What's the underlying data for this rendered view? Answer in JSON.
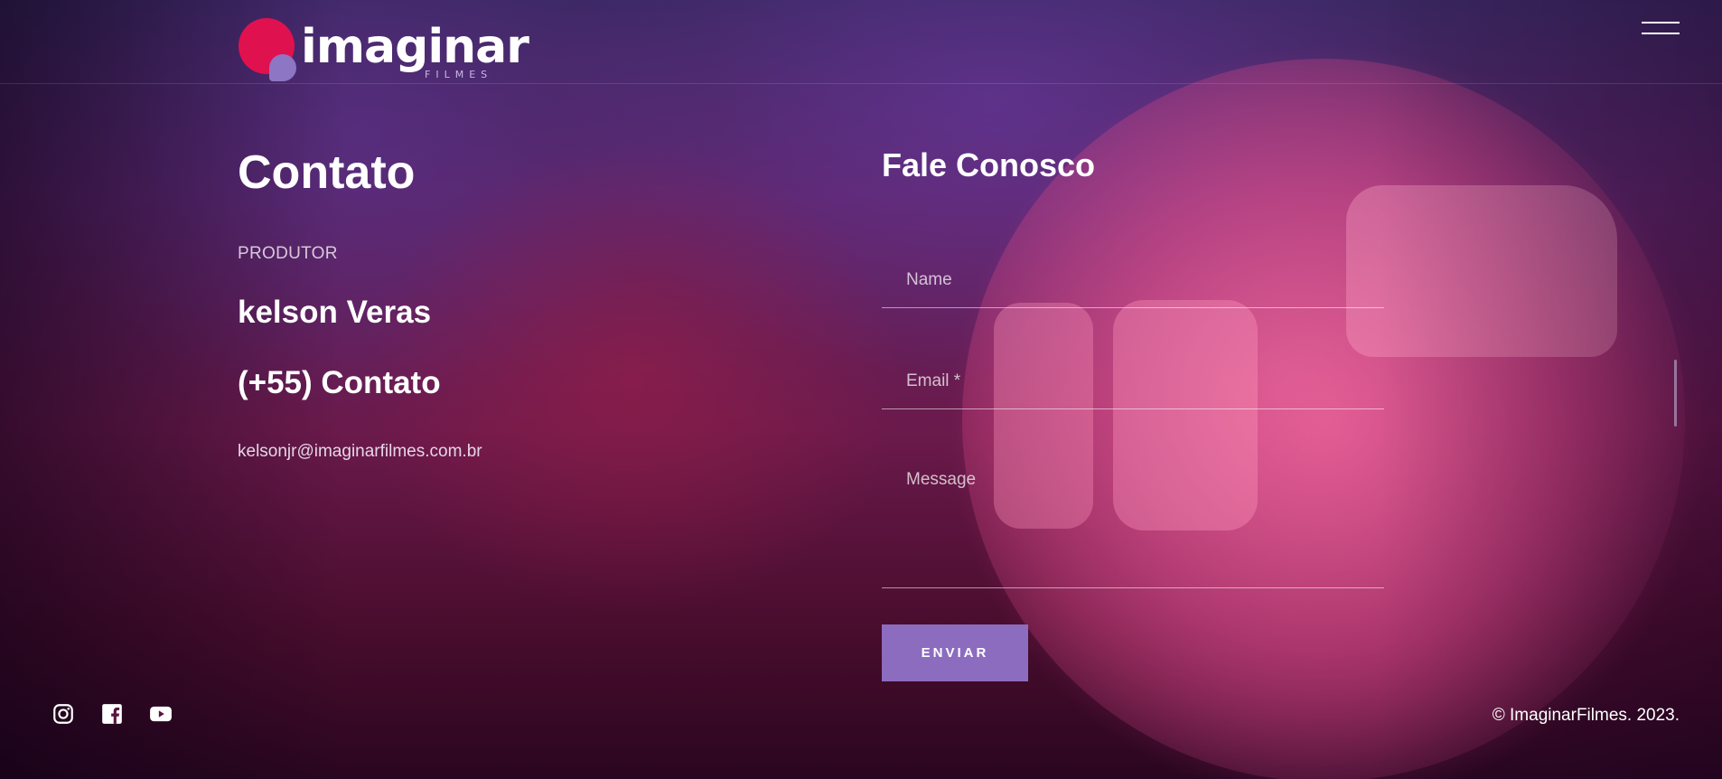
{
  "brand": {
    "logo_word": "imaginar",
    "logo_sub": "FILMES",
    "colors": {
      "red": "#e0114f",
      "purple": "#8d76c3",
      "button": "#8c6cbf"
    }
  },
  "header": {
    "menu_icon": "hamburger-menu-icon"
  },
  "contact": {
    "title": "Contato",
    "role": "PRODUTOR",
    "name": "kelson Veras",
    "phone": "(+55) Contato",
    "email": "kelsonjr@imaginarfilmes.com.br"
  },
  "form": {
    "title": "Fale Conosco",
    "name_placeholder": "Name",
    "email_placeholder": "Email *",
    "message_placeholder": "Message",
    "submit_label": "ENVIAR"
  },
  "footer": {
    "social": [
      "instagram-icon",
      "facebook-icon",
      "youtube-icon"
    ],
    "copyright": "© ImaginarFilmes. 2023."
  }
}
